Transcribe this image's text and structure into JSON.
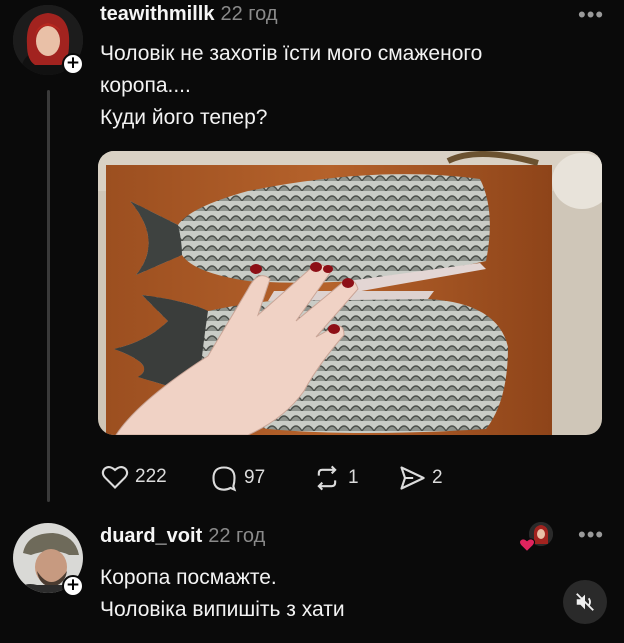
{
  "post": {
    "username": "teawithmillk",
    "time": "22 год",
    "text_line1": "Чоловік не захотів їсти мого смаженого",
    "text_line2": "коропа....",
    "text_line3": "Куди його тепер?",
    "image_alt": "photo of two raw carp fish on a cutting board with a hand"
  },
  "metrics": {
    "likes": "222",
    "replies": "97",
    "reposts": "1",
    "shares": "2"
  },
  "reply": {
    "username": "duard_voit",
    "time": "22 год",
    "text_line1": "Коропа посмажте.",
    "text_line2": "Чоловіка випишіть з хати"
  },
  "icons": {
    "more": "more-horizontal-icon",
    "like": "heart-icon",
    "reply": "comment-icon",
    "repost": "repost-icon",
    "share": "send-icon",
    "mute": "speaker-muted-icon"
  },
  "colors": {
    "background": "#0a0a0a",
    "like_red": "#e0245e"
  }
}
